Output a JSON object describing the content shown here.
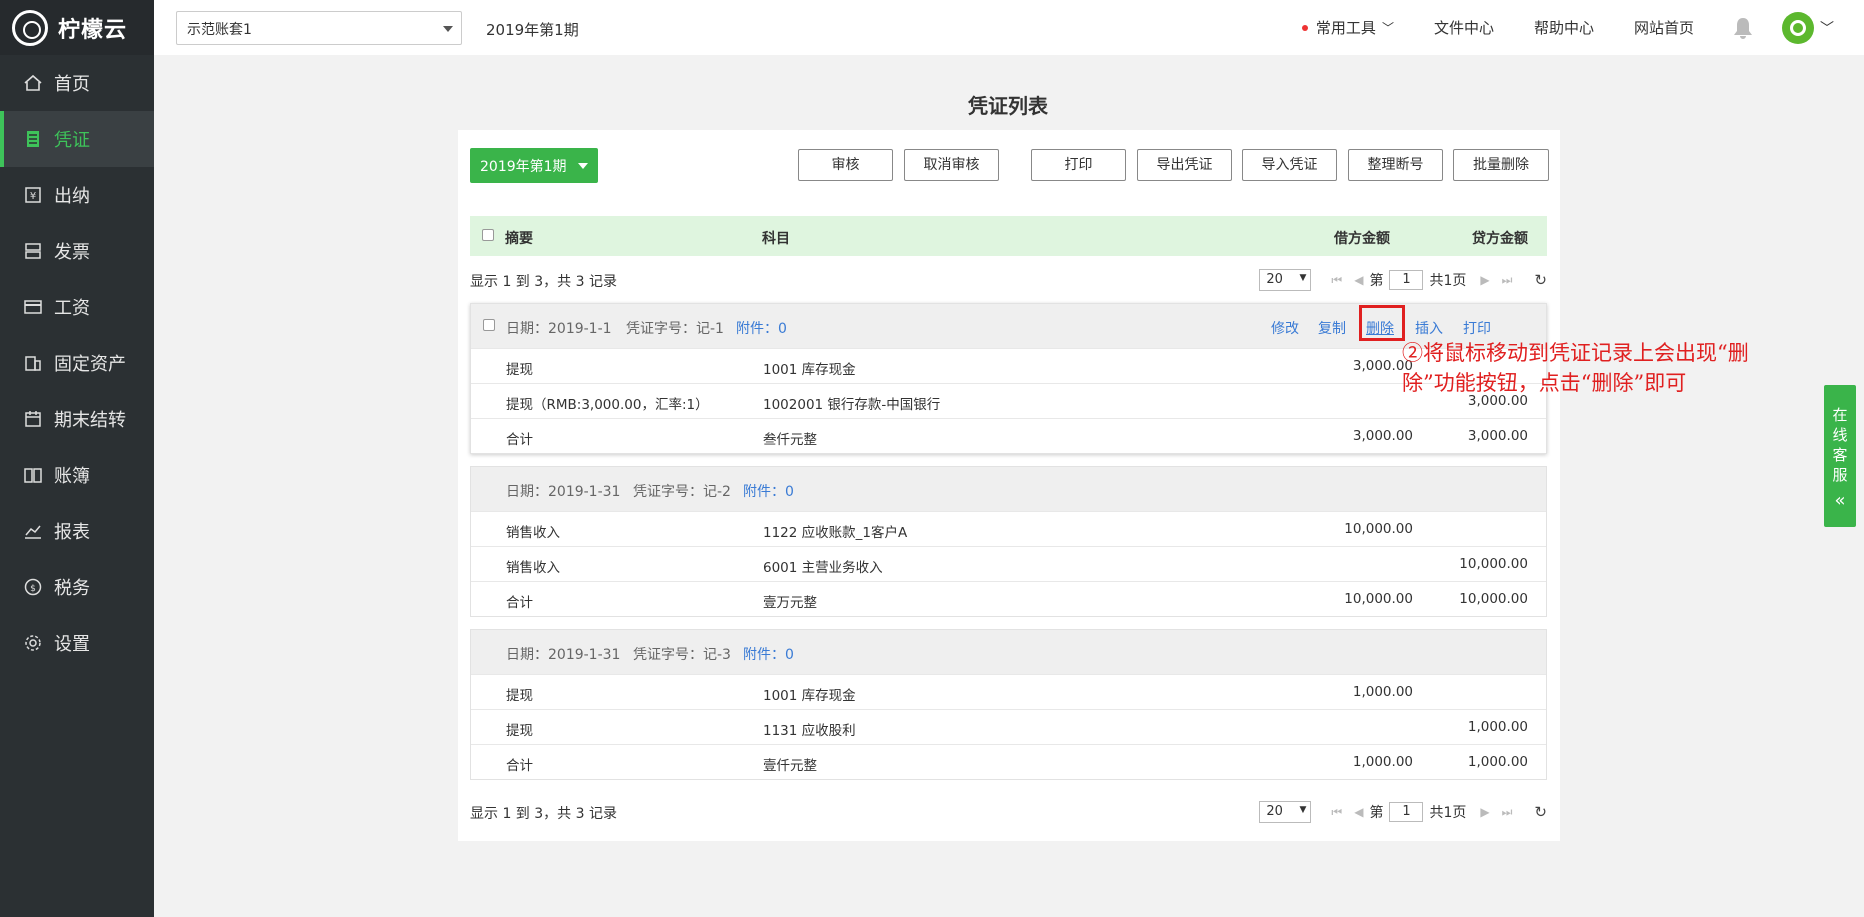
{
  "app": {
    "logo_text": "柠檬云"
  },
  "sidebar": {
    "items": [
      {
        "label": "首页",
        "icon": "home-icon"
      },
      {
        "label": "凭证",
        "icon": "voucher-icon"
      },
      {
        "label": "出纳",
        "icon": "cashier-icon"
      },
      {
        "label": "发票",
        "icon": "invoice-icon"
      },
      {
        "label": "工资",
        "icon": "salary-icon"
      },
      {
        "label": "固定资产",
        "icon": "building-icon"
      },
      {
        "label": "期末结转",
        "icon": "calendar-icon"
      },
      {
        "label": "账簿",
        "icon": "book-icon"
      },
      {
        "label": "报表",
        "icon": "chart-icon"
      },
      {
        "label": "税务",
        "icon": "coin-icon"
      },
      {
        "label": "设置",
        "icon": "gear-icon"
      }
    ],
    "active_index": 1
  },
  "header": {
    "account": "示范账套1",
    "period": "2019年第1期",
    "tools": "常用工具",
    "file_center": "文件中心",
    "help_center": "帮助中心",
    "site_home": "网站首页"
  },
  "page": {
    "title": "凭证列表"
  },
  "toolbar": {
    "period_button": "2019年第1期",
    "audit": "审核",
    "cancel_audit": "取消审核",
    "print": "打印",
    "export": "导出凭证",
    "import": "导入凭证",
    "renumber": "整理断号",
    "batch_delete": "批量删除"
  },
  "table": {
    "headers": {
      "summary": "摘要",
      "subject": "科目",
      "debit": "借方金额",
      "credit": "贷方金额"
    }
  },
  "pagination": {
    "summary": "显示 1 到 3，共 3 记录",
    "page_size": "20",
    "page_prefix": "第",
    "current_page": "1",
    "total_pages": "共1页"
  },
  "vouchers": [
    {
      "date": "日期：2019-1-1",
      "number": "凭证字号：记-1",
      "attach": "附件：0",
      "actions": {
        "edit": "修改",
        "copy": "复制",
        "delete": "删除",
        "insert": "插入",
        "print": "打印"
      },
      "rows": [
        {
          "summary": "提现",
          "subject": "1001 库存现金",
          "debit": "3,000.00",
          "credit": ""
        },
        {
          "summary": "提现（RMB:3,000.00，汇率:1）",
          "subject": "1002001 银行存款-中国银行",
          "debit": "",
          "credit": "3,000.00"
        },
        {
          "summary": "合计",
          "subject": "叁仟元整",
          "debit": "3,000.00",
          "credit": "3,000.00"
        }
      ]
    },
    {
      "date": "日期：2019-1-31",
      "number": "凭证字号：记-2",
      "attach": "附件：0",
      "rows": [
        {
          "summary": "销售收入",
          "subject": "1122 应收账款_1客户A",
          "debit": "10,000.00",
          "credit": ""
        },
        {
          "summary": "销售收入",
          "subject": "6001 主营业务收入",
          "debit": "",
          "credit": "10,000.00"
        },
        {
          "summary": "合计",
          "subject": "壹万元整",
          "debit": "10,000.00",
          "credit": "10,000.00"
        }
      ]
    },
    {
      "date": "日期：2019-1-31",
      "number": "凭证字号：记-3",
      "attach": "附件：0",
      "rows": [
        {
          "summary": "提现",
          "subject": "1001 库存现金",
          "debit": "1,000.00",
          "credit": ""
        },
        {
          "summary": "提现",
          "subject": "1131 应收股利",
          "debit": "",
          "credit": "1,000.00"
        },
        {
          "summary": "合计",
          "subject": "壹仟元整",
          "debit": "1,000.00",
          "credit": "1,000.00"
        }
      ]
    }
  ],
  "annotation": {
    "line1": "②将鼠标移动到凭证记录上会出现“删",
    "line2": "除”功能按钮，点击“删除”即可"
  },
  "service": {
    "label": "在线客服",
    "collapse": "«"
  },
  "colors": {
    "accent": "#3ab44a",
    "sidebar_bg": "#2b3033",
    "link": "#3a7bd5",
    "annotation": "#e02020"
  }
}
